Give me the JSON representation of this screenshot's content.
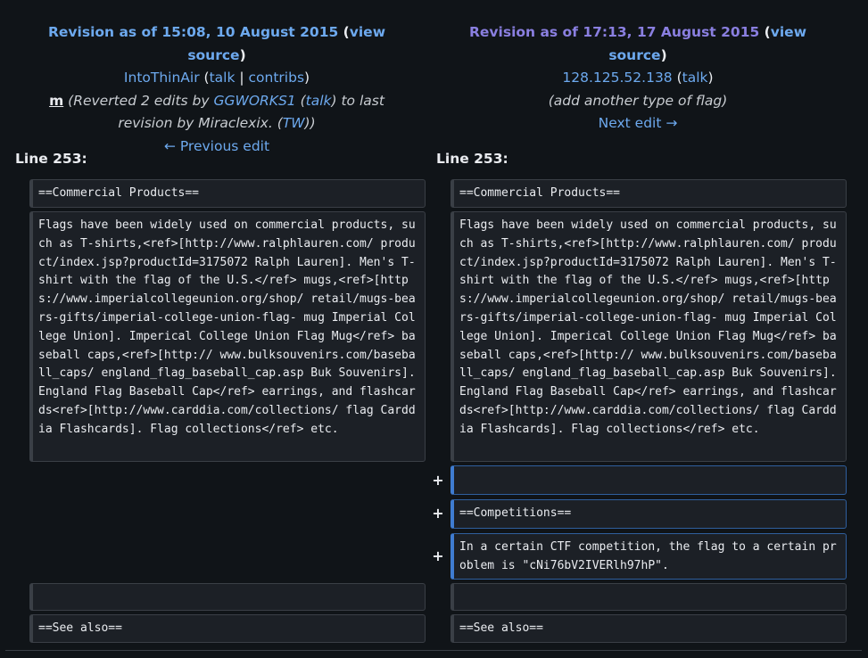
{
  "left_header": {
    "revision_label": "Revision as of 15:08, 10 August 2015",
    "view_source": "view source",
    "user": "IntoThinAir",
    "talk": "talk",
    "contribs": "contribs",
    "minor_mark": "m",
    "summary_prefix": "(Reverted 2 edits by ",
    "summary_user": "GGWORKS1",
    "summary_mid": " (",
    "summary_talk": "talk",
    "summary_suffix": ") to last revision by Miraclexix. (",
    "summary_tw": "TW",
    "summary_end": "))",
    "prev_edit": "← Previous edit"
  },
  "right_header": {
    "revision_label": "Revision as of 17:13, 17 August 2015",
    "view_source": "view source",
    "user": "128.125.52.138",
    "talk": "talk",
    "summary": "(add another type of flag)",
    "next_edit": "Next edit →"
  },
  "line_label_left": "Line 253:",
  "line_label_right": "Line 253:",
  "diff": {
    "commercial_heading": "==Commercial Products==",
    "flags_paragraph": "Flags have been widely used on commercial products, such as T-shirts,<ref>[http://www.ralphlauren.com/ product/index.jsp?productId=3175072 Ralph Lauren]. Men's T-shirt with the flag of the U.S.</ref> mugs,<ref>[https://www.imperialcollegeunion.org/shop/ retail/mugs-bears-gifts/imperial-college-union-flag- mug Imperial College Union]. Imperical College Union Flag Mug</ref> baseball caps,<ref>[http:// www.bulksouvenirs.com/baseball_caps/ england_flag_baseball_cap.asp Buk Souvenirs]. England Flag Baseball Cap</ref> earrings, and flashcards<ref>[http://www.carddia.com/collections/ flag Carddia Flashcards]. Flag collections</ref> etc.",
    "added_blank": "",
    "competitions_heading": "==Competitions==",
    "ctf_line": "In a certain CTF competition, the flag to a certain problem is \"cNi76bV2IVERlh97hP\".",
    "blank": "",
    "see_also": "==See also==",
    "plus": "+"
  }
}
